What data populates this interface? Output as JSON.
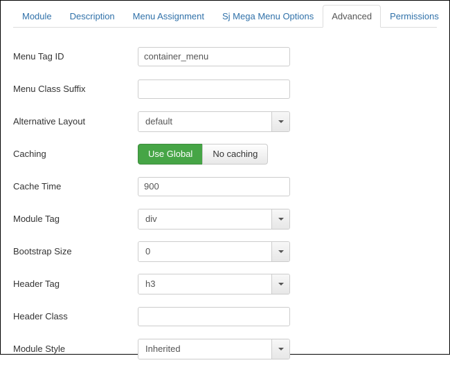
{
  "tabs": {
    "t0": "Module",
    "t1": "Description",
    "t2": "Menu Assignment",
    "t3": "Sj Mega Menu Options",
    "t4": "Advanced",
    "t5": "Permissions"
  },
  "fields": {
    "menu_tag_id": {
      "label": "Menu Tag ID",
      "value": "container_menu"
    },
    "menu_class_suffix": {
      "label": "Menu Class Suffix",
      "value": ""
    },
    "alternative_layout": {
      "label": "Alternative Layout",
      "value": "default"
    },
    "caching": {
      "label": "Caching",
      "options": {
        "use_global": "Use Global",
        "no_caching": "No caching"
      }
    },
    "cache_time": {
      "label": "Cache Time",
      "value": "900"
    },
    "module_tag": {
      "label": "Module Tag",
      "value": "div"
    },
    "bootstrap_size": {
      "label": "Bootstrap Size",
      "value": "0"
    },
    "header_tag": {
      "label": "Header Tag",
      "value": "h3"
    },
    "header_class": {
      "label": "Header Class",
      "value": ""
    },
    "module_style": {
      "label": "Module Style",
      "value": "Inherited"
    }
  }
}
